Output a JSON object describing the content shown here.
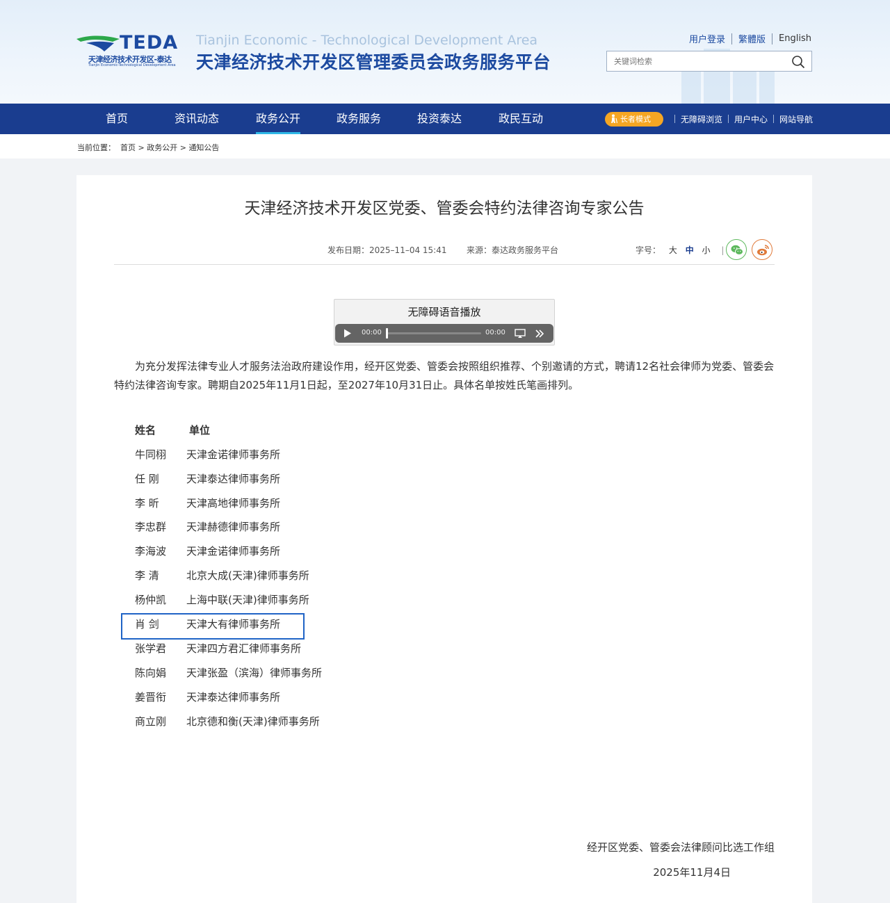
{
  "header": {
    "logo_text": "TEDA",
    "logo_cn": "天津经济技术开发区-泰达",
    "logo_en": "Tianjin Economic-Technological Development Area",
    "site_en": "Tianjin Economic - Technological Development Area",
    "site_cn": "天津经济技术开发区管理委员会政务服务平台",
    "links": {
      "login": "用户登录",
      "traditional": "繁體版",
      "english": "English"
    },
    "search_placeholder": "关键词检索"
  },
  "nav": {
    "items": [
      {
        "label": "首页"
      },
      {
        "label": "资讯动态"
      },
      {
        "label": "政务公开"
      },
      {
        "label": "政务服务"
      },
      {
        "label": "投资泰达"
      },
      {
        "label": "政民互动"
      }
    ],
    "active": "政务公开",
    "elder_mode": "长者模式",
    "right": {
      "accessible": "无障碍浏览",
      "user_center": "用户中心",
      "site_nav": "网站导航"
    }
  },
  "breadcrumb": {
    "prefix": "当前位置：",
    "items": [
      "首页",
      "政务公开",
      "通知公告"
    ],
    "separator": ">"
  },
  "article": {
    "title": "天津经济技术开发区党委、管委会特约法律咨询专家公告",
    "date_label": "发布日期：",
    "date": "2025–11–04 15:41",
    "source_label": "来源：",
    "source": "泰达政务服务平台",
    "font_label": "字号：",
    "font_sizes": [
      "大",
      "中",
      "小"
    ],
    "font_current": "中",
    "divider_char": "|",
    "player": {
      "title": "无障碍语音播放",
      "current": "00:00",
      "duration": "00:00"
    },
    "intro": "为充分发挥法律专业人才服务法治政府建设作用，经开区党委、管委会按照组织推荐、个别邀请的方式，聘请12名社会律师为党委、管委会特约法律咨询专家。聘期自2025年11月1日起，至2027年10月31日止。具体名单按姓氏笔画排列。",
    "table_headers": {
      "name": "姓名",
      "unit": "单位"
    },
    "experts": [
      {
        "name": "牛同栩",
        "unit": "天津金诺律师事务所"
      },
      {
        "name": "任  刚",
        "unit": "天津泰达律师事务所"
      },
      {
        "name": "李  昕",
        "unit": "天津高地律师事务所"
      },
      {
        "name": "李忠群",
        "unit": "天津赫德律师事务所"
      },
      {
        "name": "李海波",
        "unit": "天津金诺律师事务所"
      },
      {
        "name": "李  清",
        "unit": "北京大成(天津)律师事务所"
      },
      {
        "name": "杨仲凯",
        "unit": "上海中联(天津)律师事务所"
      },
      {
        "name": "肖  剑",
        "unit": "天津大有律师事务所"
      },
      {
        "name": "张学君",
        "unit": "天津四方君汇律师事务所"
      },
      {
        "name": "陈向娟",
        "unit": "天津张盈（滨海）律师事务所"
      },
      {
        "name": "姜晋衔",
        "unit": "天津泰达律师事务所"
      },
      {
        "name": "商立刚",
        "unit": "北京德和衡(天津)律师事务所"
      }
    ],
    "signature_org": "经开区党委、管委会法律顾问比选工作组",
    "signature_date": "2025年11月4日"
  },
  "colors": {
    "brand": "#1a3d8f",
    "accent": "#2fb8e6",
    "elder": "#f5a623",
    "highlight": "#1f63c6"
  },
  "icons": [
    "search-icon",
    "elder-mode-icon",
    "wechat-icon",
    "weibo-icon",
    "play-icon",
    "cast-icon",
    "more-icon"
  ]
}
